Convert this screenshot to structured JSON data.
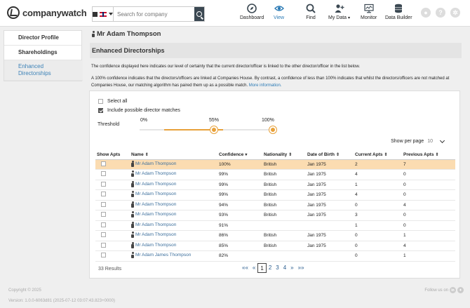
{
  "header": {
    "logo_text": "companywatch",
    "search_placeholder": "Search for company",
    "nav": [
      {
        "label": "Dashboard",
        "icon": "compass-icon"
      },
      {
        "label": "View",
        "icon": "eye-icon",
        "active": true
      },
      {
        "label": "Find",
        "icon": "search-icon"
      },
      {
        "label": "My Data",
        "icon": "user-plus-icon"
      },
      {
        "label": "Monitor",
        "icon": "monitor-icon"
      },
      {
        "label": "Data Builder",
        "icon": "database-icon"
      }
    ]
  },
  "sidebar": {
    "items": [
      {
        "label": "Director Profile"
      },
      {
        "label": "Shareholdings"
      },
      {
        "label": "Enhanced Directorships",
        "active": true
      }
    ]
  },
  "main": {
    "person_name": "Mr Adam Thompson",
    "section_title": "Enhanced Directorships",
    "para1": "The confidence displayed here indicates our level of certainty that the current director/officer is linked to the other director/officer in the list below.",
    "para2": "A 100% confidence indicates that the directors/officers are linked at Companies House. By contrast, a confidence of less than 100% indicates that whilst the directors/officers are not matched at Companies House, our matching algorithm has paired them up as a possible match.",
    "more_info": "More information.",
    "select_all": "Select all",
    "include_matches": "Include possible director matches",
    "threshold_label": "Threshold",
    "threshold_ticks": [
      "0%",
      "55%",
      "100%"
    ],
    "threshold_value_min": 55,
    "threshold_value_max": 100,
    "show_per_page_label": "Show per page",
    "show_per_page_value": "10",
    "table": {
      "columns": [
        "Show Apts",
        "Name",
        "Confidence",
        "Nationality",
        "Date of Birth",
        "Current Apts",
        "Previous Apts"
      ],
      "rows": [
        {
          "name": "Mr Adam Thompson",
          "confidence": "100%",
          "nationality": "British",
          "dob": "Jan 1975",
          "current": "2",
          "previous": "7",
          "highlight": true
        },
        {
          "name": "Mr Adam Thompson",
          "confidence": "99%",
          "nationality": "British",
          "dob": "Jan 1975",
          "current": "4",
          "previous": "0"
        },
        {
          "name": "Mr Adam Thompson",
          "confidence": "99%",
          "nationality": "British",
          "dob": "Jan 1975",
          "current": "1",
          "previous": "0"
        },
        {
          "name": "Mr Adam Thompson",
          "confidence": "99%",
          "nationality": "British",
          "dob": "Jan 1975",
          "current": "4",
          "previous": "0"
        },
        {
          "name": "Mr Adam Thompson",
          "confidence": "94%",
          "nationality": "British",
          "dob": "Jan 1975",
          "current": "0",
          "previous": "4"
        },
        {
          "name": "Mr Adam Thompson",
          "confidence": "93%",
          "nationality": "British",
          "dob": "Jan 1975",
          "current": "3",
          "previous": "0"
        },
        {
          "name": "Mr Adam Thompson",
          "confidence": "91%",
          "nationality": "",
          "dob": "",
          "current": "1",
          "previous": "0"
        },
        {
          "name": "Mr Adam Thompson",
          "confidence": "86%",
          "nationality": "British",
          "dob": "Jan 1975",
          "current": "0",
          "previous": "1"
        },
        {
          "name": "Mr Adam Thompson",
          "confidence": "85%",
          "nationality": "British",
          "dob": "Jan 1975",
          "current": "0",
          "previous": "4"
        },
        {
          "name": "Mr Adam James Thompson",
          "confidence": "82%",
          "nationality": "",
          "dob": "",
          "current": "0",
          "previous": "1"
        }
      ]
    },
    "results_count": "33 Results",
    "pagination": [
      "««",
      "«",
      "1",
      "2",
      "3",
      "4",
      "»",
      "»»"
    ],
    "current_page": "1"
  },
  "footer": {
    "copyright": "Copyright © 2025",
    "version": "Version: 1.0.0-6063d81 (2025-07-12 03:07:43.823+0000)",
    "follow": "Follow us on",
    "social": [
      "in",
      "tw"
    ]
  },
  "colors": {
    "accent": "#2a7ab5",
    "highlight_row": "#fbdcb1",
    "slider": "#e8a13a",
    "search_btn": "#3b4852"
  }
}
